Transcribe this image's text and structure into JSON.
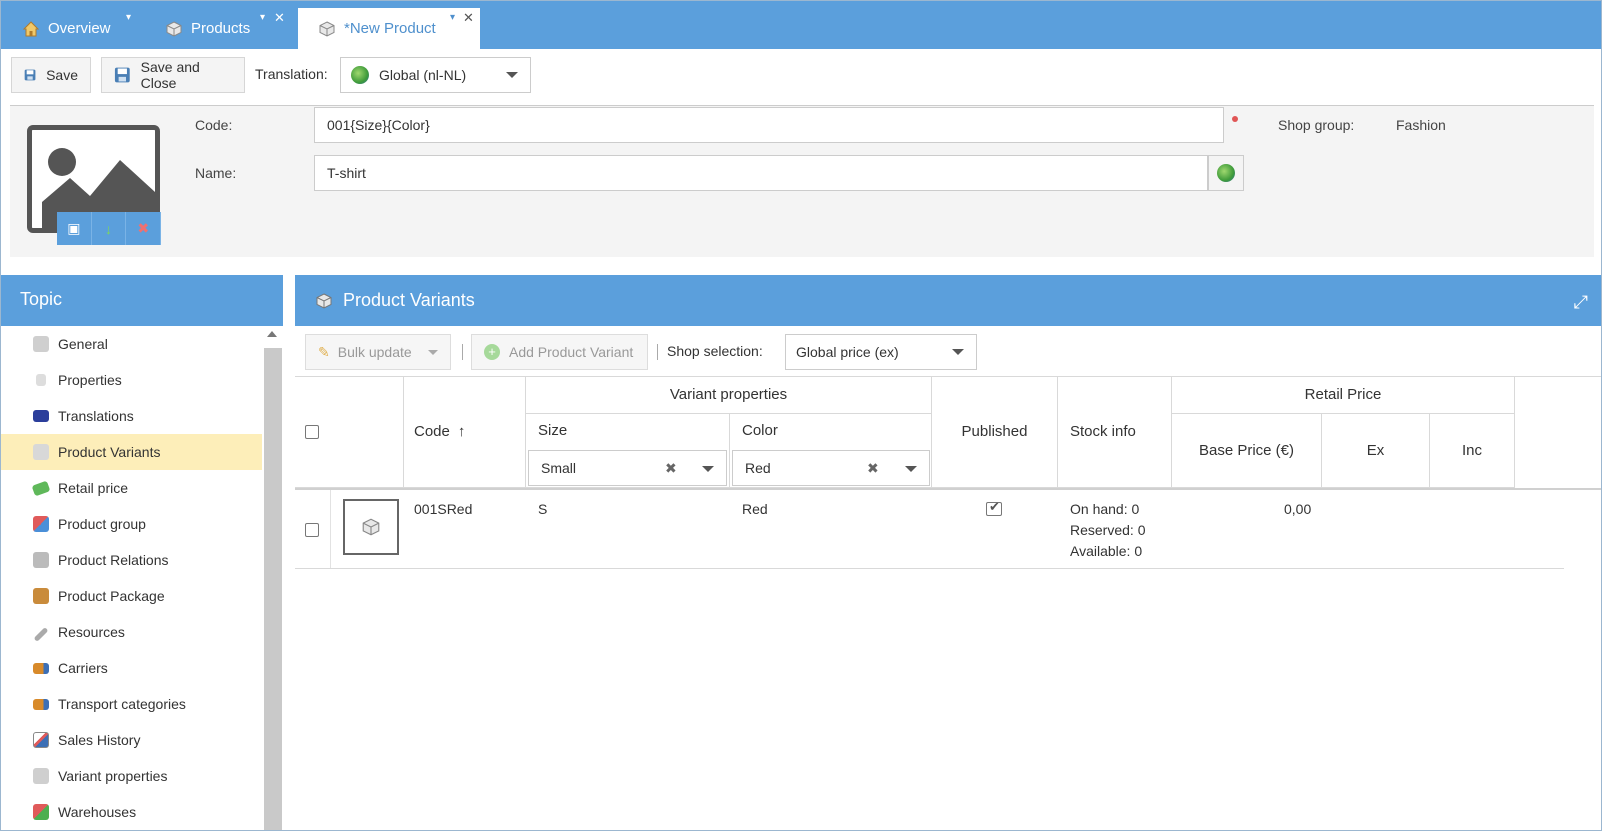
{
  "tabs": [
    {
      "label": "Overview",
      "icon": "home-icon"
    },
    {
      "label": "Products",
      "icon": "cube-icon"
    },
    {
      "label": "*New Product",
      "icon": "cube-icon"
    }
  ],
  "toolbar": {
    "save_label": "Save",
    "save_close_label": "Save and Close",
    "translation_label": "Translation:",
    "translation_value": "Global (nl-NL)"
  },
  "product": {
    "code_label": "Code:",
    "code_value": "001{Size}{Color}",
    "name_label": "Name:",
    "name_value": "T-shirt",
    "shop_group_label": "Shop group:",
    "shop_group_value": "Fashion"
  },
  "sidebar": {
    "title": "Topic",
    "items": [
      {
        "label": "General",
        "icon": "cube-icon"
      },
      {
        "label": "Properties",
        "icon": "property-icon"
      },
      {
        "label": "Translations",
        "icon": "flag-icon"
      },
      {
        "label": "Product Variants",
        "icon": "cubes-icon",
        "selected": true
      },
      {
        "label": "Retail price",
        "icon": "money-icon"
      },
      {
        "label": "Product group",
        "icon": "group-icon"
      },
      {
        "label": "Product Relations",
        "icon": "relations-icon"
      },
      {
        "label": "Product Package",
        "icon": "package-icon"
      },
      {
        "label": "Resources",
        "icon": "attachment-icon"
      },
      {
        "label": "Carriers",
        "icon": "truck-icon"
      },
      {
        "label": "Transport categories",
        "icon": "truck-icon"
      },
      {
        "label": "Sales History",
        "icon": "chart-icon"
      },
      {
        "label": "Variant properties",
        "icon": "cubes-icon"
      },
      {
        "label": "Warehouses",
        "icon": "warehouse-icon"
      }
    ]
  },
  "variants": {
    "title": "Product Variants",
    "bulk_update_label": "Bulk update",
    "add_variant_label": "Add Product Variant",
    "shop_selection_label": "Shop selection:",
    "shop_selection_value": "Global price (ex)",
    "columns": {
      "code": "Code",
      "variant_properties": "Variant properties",
      "size": "Size",
      "color": "Color",
      "published": "Published",
      "stock_info": "Stock info",
      "retail_price": "Retail Price",
      "base_price": "Base Price (€)",
      "ex": "Ex",
      "inc": "Inc"
    },
    "filters": {
      "size": "Small",
      "color": "Red"
    },
    "rows": [
      {
        "code": "001SRed",
        "size": "S",
        "color": "Red",
        "published": true,
        "stock_on_hand": "On hand: 0",
        "stock_reserved": "Reserved: 0",
        "stock_available": "Available: 0",
        "base_price": "0,00"
      }
    ]
  }
}
